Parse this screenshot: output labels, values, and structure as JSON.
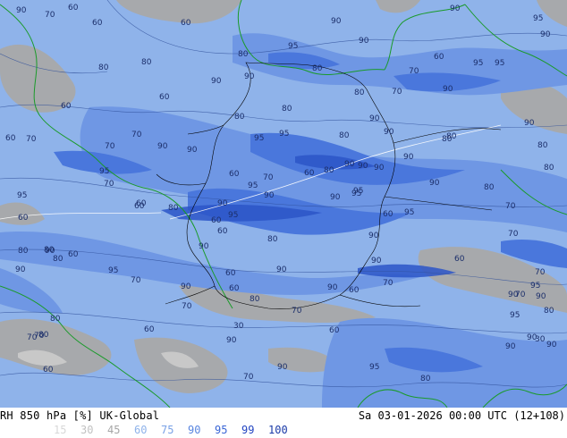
{
  "footer": {
    "title": "RH 850 hPa [%] UK-Global",
    "valid_time": "Sa 03-01-2026 00:00 UTC (12+108)"
  },
  "legend": {
    "items": [
      {
        "label": "15",
        "color": "#d8d8d8"
      },
      {
        "label": "30",
        "color": "#c2c2c2"
      },
      {
        "label": "45",
        "color": "#a6a6a6"
      },
      {
        "label": "60",
        "color": "#8fb3ea"
      },
      {
        "label": "75",
        "color": "#7aa2e6"
      },
      {
        "label": "90",
        "color": "#5a86e0"
      },
      {
        "label": "95",
        "color": "#3a66d6"
      },
      {
        "label": "99",
        "color": "#2446c2"
      },
      {
        "label": "100",
        "color": "#1a3aa8"
      }
    ]
  },
  "contour_labels": [
    "90",
    "70",
    "60",
    "60",
    "60",
    "90",
    "90",
    "90",
    "95",
    "80",
    "95",
    "90",
    "70",
    "60",
    "80",
    "80",
    "90",
    "80",
    "70",
    "80",
    "95",
    "90",
    "95",
    "60",
    "60",
    "90",
    "80",
    "70",
    "95",
    "70",
    "90",
    "80",
    "60",
    "80",
    "70",
    "95",
    "80",
    "90",
    "80",
    "90",
    "60",
    "70",
    "90",
    "95",
    "60",
    "80",
    "90",
    "90",
    "60",
    "70",
    "95",
    "60",
    "80",
    "90",
    "95",
    "90",
    "90",
    "60",
    "80",
    "80",
    "70",
    "95",
    "80",
    "90",
    "90",
    "90",
    "95",
    "90",
    "90",
    "95",
    "90",
    "80",
    "90",
    "70",
    "60",
    "90",
    "80",
    "80",
    "70",
    "60",
    "90",
    "95",
    "95",
    "60",
    "80",
    "60",
    "60",
    "70",
    "60",
    "60",
    "80",
    "95",
    "90",
    "90",
    "70",
    "60",
    "80",
    "70",
    "90",
    "60",
    "80",
    "70",
    "90",
    "30",
    "60",
    "70",
    "60",
    "90",
    "30",
    "70",
    "90",
    "80",
    "95",
    "70",
    "95",
    "90",
    "90",
    "90",
    "80",
    "90",
    "70"
  ]
}
